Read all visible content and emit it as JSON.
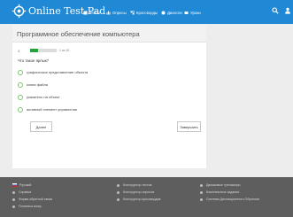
{
  "header": {
    "brand": "Online Test Pad",
    "nav": [
      {
        "label": "Тесты",
        "icon": "tests-icon"
      },
      {
        "label": "Опросы",
        "icon": "polls-icon"
      },
      {
        "label": "Кроссворды",
        "icon": "crosswords-icon"
      },
      {
        "label": "Диалоги",
        "icon": "dialogs-icon"
      },
      {
        "label": "Уроки",
        "icon": "lessons-icon"
      }
    ]
  },
  "test": {
    "title": "Программное обеспечение компьютера",
    "question_number": "1",
    "progress_text": "1 из 10",
    "progress_fraction": 0.3,
    "question": "Что такое ярлык?",
    "options": [
      "графическое представление объекта",
      "копия файла",
      "указатель на объект",
      "активный элемент управления"
    ],
    "next_label": "Далее",
    "finish_label": "Завершить"
  },
  "footer": {
    "col1": [
      "Русский",
      "Справка",
      "Форма обратной связи",
      "Политика конф."
    ],
    "col2": [
      "Конструктор тестов",
      "Конструктор опросов",
      "Конструктор кроссвордов"
    ],
    "col3": [
      "Движковые тренажеры",
      "Комплексные задания",
      "Система Дистанционного Обучения"
    ]
  },
  "colors": {
    "topbar": "#1f89d6",
    "progress": "#27a13b",
    "footer": "#5e5e5e"
  }
}
